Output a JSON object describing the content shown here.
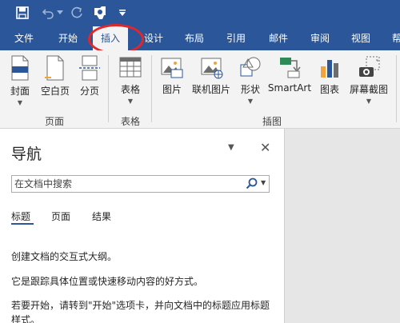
{
  "ribbon_tabs": [
    {
      "label": "文件"
    },
    {
      "label": "开始"
    },
    {
      "label": "插入"
    },
    {
      "label": "设计"
    },
    {
      "label": "布局"
    },
    {
      "label": "引用"
    },
    {
      "label": "邮件"
    },
    {
      "label": "审阅"
    },
    {
      "label": "视图"
    },
    {
      "label": "帮"
    }
  ],
  "ribbon": {
    "buttons": {
      "cover": "封面",
      "blank_page": "空白页",
      "page_break": "分页",
      "table": "表格",
      "picture": "图片",
      "online_picture": "联机图片",
      "shapes": "形状",
      "smartart": "SmartArt",
      "chart": "图表",
      "screenshot": "屏幕截图"
    },
    "groups": {
      "pages": "页面",
      "tables": "表格",
      "illustrations": "插图"
    }
  },
  "nav_pane": {
    "title": "导航",
    "search_placeholder": "在文档中搜索",
    "tabs": [
      "标题",
      "页面",
      "结果"
    ],
    "text1": "创建文档的交互式大纲。",
    "text2": "它是跟踪具体位置或快速移动内容的好方式。",
    "text3": "若要开始，请转到\"开始\"选项卡，并向文档中的标题应用标题样式。"
  },
  "colors": {
    "brand": "#2b579a",
    "annotation": "#e3262a"
  }
}
